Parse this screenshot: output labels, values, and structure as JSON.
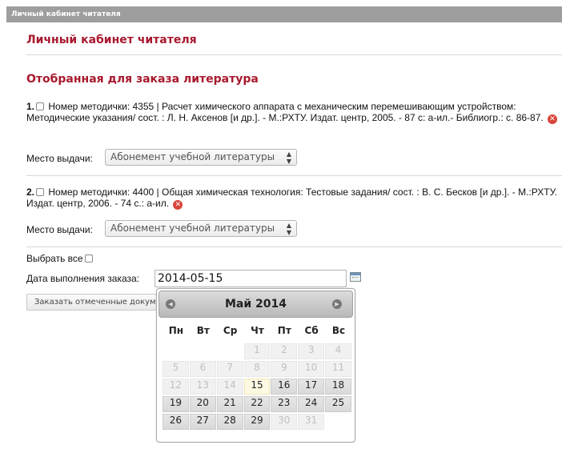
{
  "header": {
    "bar_title": "Личный кабинет читателя"
  },
  "page": {
    "title": "Личный кабинет читателя",
    "section_title": "Отобранная для заказа литература"
  },
  "items": [
    {
      "number": "1.",
      "description": "Номер методички: 4355 | Расчет химического аппарата с механическим перемешивающим устройством: Методические указания/ сост. : Л. Н. Аксенов [и др.]. - М.:РХТУ. Издат. центр, 2005. - 87 с: а-ил.- Библиогр.: с. 86-87.",
      "place_label": "Место выдачи:",
      "place_value": "Абонемент учебной литературы"
    },
    {
      "number": "2.",
      "description": "Номер методички: 4400 | Общая химическая технология: Тестовые задания/ сост. : В. С. Бесков [и др.]. - М.:РХТУ. Издат. центр, 2006. - 74 с.: а-ил.",
      "place_label": "Место выдачи:",
      "place_value": "Абонемент учебной литературы"
    }
  ],
  "select_all_label": "Выбрать все",
  "date": {
    "label": "Дата выполнения заказа:",
    "value": "2014-05-15"
  },
  "order_button_label": "Заказать отмеченные докум",
  "datepicker": {
    "title": "Май 2014",
    "prev_icon": "◀",
    "next_icon": "▶",
    "weekdays": [
      "Пн",
      "Вт",
      "Ср",
      "Чт",
      "Пт",
      "Сб",
      "Вс"
    ],
    "leading_empty": 3,
    "days": [
      {
        "d": "1",
        "state": "disabled"
      },
      {
        "d": "2",
        "state": "disabled"
      },
      {
        "d": "3",
        "state": "disabled"
      },
      {
        "d": "4",
        "state": "disabled"
      },
      {
        "d": "5",
        "state": "disabled"
      },
      {
        "d": "6",
        "state": "disabled"
      },
      {
        "d": "7",
        "state": "disabled"
      },
      {
        "d": "8",
        "state": "disabled"
      },
      {
        "d": "9",
        "state": "disabled"
      },
      {
        "d": "10",
        "state": "disabled"
      },
      {
        "d": "11",
        "state": "disabled"
      },
      {
        "d": "12",
        "state": "disabled"
      },
      {
        "d": "13",
        "state": "disabled"
      },
      {
        "d": "14",
        "state": "disabled"
      },
      {
        "d": "15",
        "state": "selected"
      },
      {
        "d": "16",
        "state": "enabled"
      },
      {
        "d": "17",
        "state": "enabled"
      },
      {
        "d": "18",
        "state": "enabled"
      },
      {
        "d": "19",
        "state": "enabled"
      },
      {
        "d": "20",
        "state": "enabled"
      },
      {
        "d": "21",
        "state": "enabled"
      },
      {
        "d": "22",
        "state": "enabled"
      },
      {
        "d": "23",
        "state": "enabled"
      },
      {
        "d": "24",
        "state": "enabled"
      },
      {
        "d": "25",
        "state": "enabled"
      },
      {
        "d": "26",
        "state": "enabled"
      },
      {
        "d": "27",
        "state": "enabled"
      },
      {
        "d": "28",
        "state": "enabled"
      },
      {
        "d": "29",
        "state": "enabled"
      },
      {
        "d": "30",
        "state": "disabled"
      },
      {
        "d": "31",
        "state": "disabled"
      }
    ]
  },
  "colors": {
    "accent": "#a8192e",
    "remove": "#d9463b",
    "header_bar": "#9e9e9e"
  }
}
